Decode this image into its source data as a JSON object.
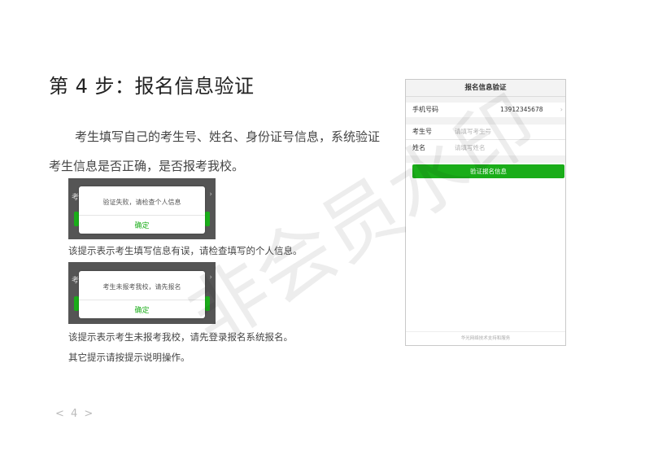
{
  "slide": {
    "title": "第 4 步：报名信息验证",
    "paragraph_line1": "考生填写自己的考生号、姓名、身份证号信息，系统验证",
    "paragraph_line2": "考生信息是否正确，是否报考我校。"
  },
  "dialogs": [
    {
      "edge_label": "考",
      "message": "验证失败，请检查个人信息",
      "ok_label": "确定",
      "caption": "该提示表示考生填写信息有误，请检查填写的个人信息。"
    },
    {
      "edge_label": "考",
      "message": "考生未报考我校，请先报名",
      "ok_label": "确定",
      "caption": "该提示表示考生未报考我校，请先登录报名系统报名。"
    }
  ],
  "other_note": "其它提示请按提示说明操作。",
  "phone": {
    "header_title": "报名信息验证",
    "phone_label": "手机号码",
    "phone_value": "13912345678",
    "exam_no_label": "考生号",
    "exam_no_placeholder": "请填写考生号",
    "name_label": "姓名",
    "name_placeholder": "请填写姓名",
    "verify_button": "验证报名信息",
    "footer": "华光网络技术支持和服务"
  },
  "page_indicator": "< 4 >",
  "watermark_text": "非会员水印",
  "colors": {
    "accent_green": "#1aad19"
  }
}
